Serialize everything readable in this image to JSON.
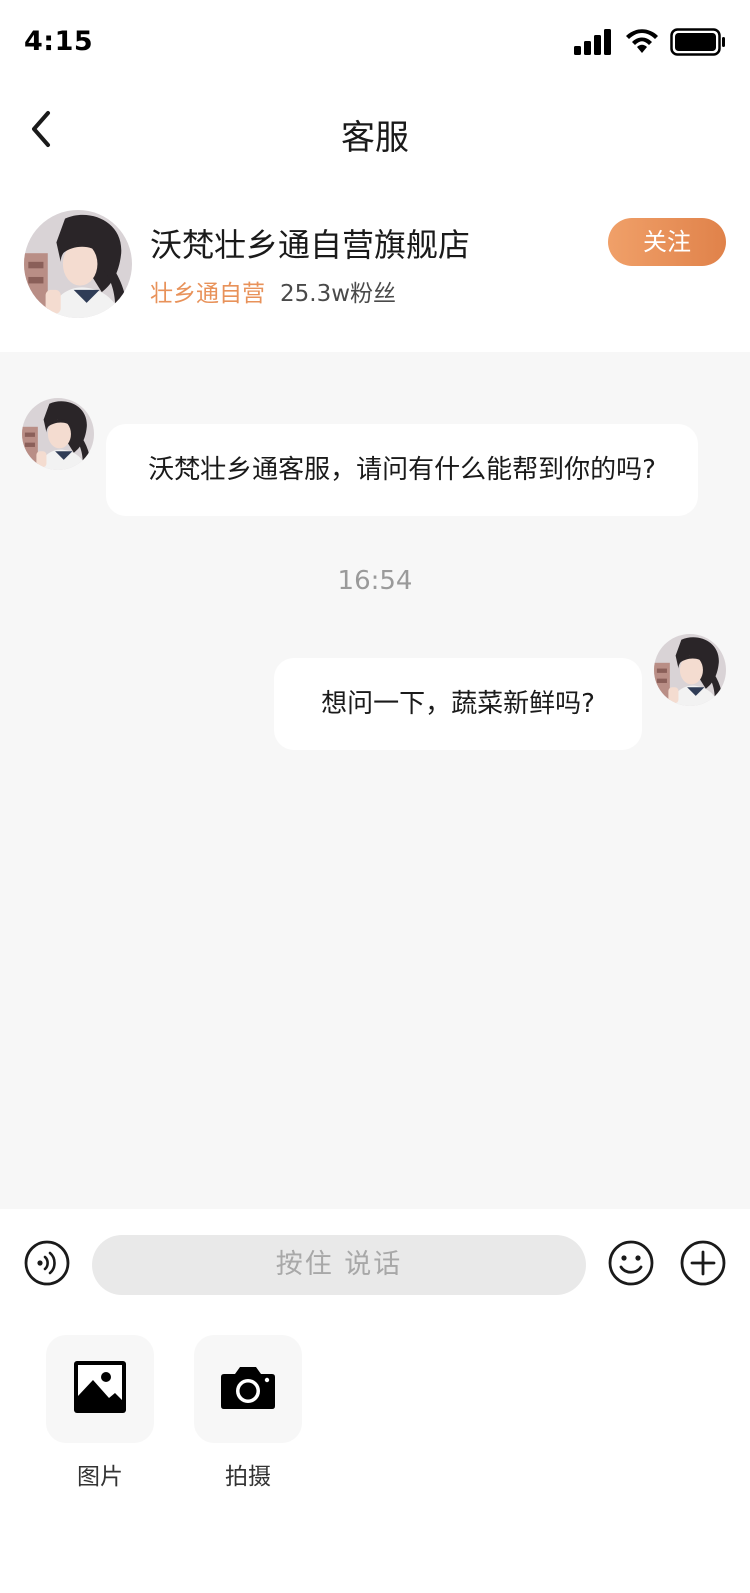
{
  "status_bar": {
    "time": "4:15"
  },
  "nav": {
    "title": "客服"
  },
  "store": {
    "name": "沃梵壮乡通自营旗舰店",
    "tag": "壮乡通自营",
    "fans": "25.3w粉丝",
    "follow_label": "关注"
  },
  "chat": {
    "messages": [
      {
        "from": "store",
        "text": "沃梵壮乡通客服，请问有什么能帮到你的吗?"
      },
      {
        "from": "user",
        "text": "想问一下，蔬菜新鲜吗?"
      }
    ],
    "timestamp": "16:54"
  },
  "input": {
    "hold_talk_label": "按住  说话"
  },
  "panel": {
    "items": [
      {
        "label": "图片",
        "icon": "image-icon"
      },
      {
        "label": "拍摄",
        "icon": "camera-icon"
      }
    ]
  },
  "colors": {
    "accent": "#e8925a",
    "chat_bg": "#f7f7f7"
  }
}
